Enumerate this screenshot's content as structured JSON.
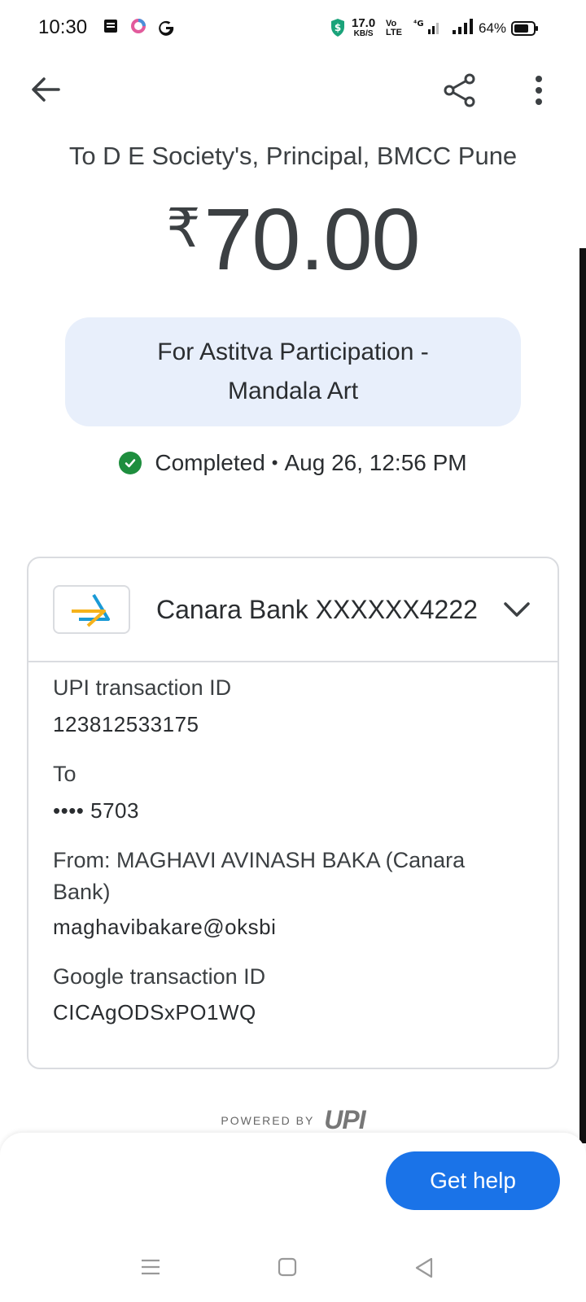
{
  "status_bar": {
    "time": "10:30",
    "speed": "17.0",
    "speed_unit": "KB/S",
    "volte": "Vo LTE",
    "network": "4G",
    "battery": "64%"
  },
  "header": {
    "payee": "To D E Society's, Principal, BMCC Pune"
  },
  "amount": {
    "currency": "₹",
    "value": "70.00"
  },
  "note": "For Astitva Participation - Mandala Art",
  "status": {
    "text": "Completed",
    "separator": "•",
    "datetime": "Aug 26, 12:56 PM"
  },
  "account": {
    "bank_label": "Canara Bank XXXXXX4222"
  },
  "details": {
    "upi_label": "UPI transaction ID",
    "upi_value": "123812533175",
    "to_label": "To",
    "to_value": "•••• 5703",
    "from_label_line1": "From: MAGHAVI AVINASH BAKA (Canara",
    "from_label_line2": "Bank)",
    "from_value": "maghavibakare@oksbi",
    "google_label": "Google transaction ID",
    "google_value": "CICAgODSxPO1WQ"
  },
  "footer": {
    "powered_by": "POWERED BY",
    "upi_logo": "UPI",
    "help_label": "Get help"
  },
  "colors": {
    "primary": "#1a73e8",
    "success": "#1e8e3e",
    "note_bg": "#e8effb"
  }
}
